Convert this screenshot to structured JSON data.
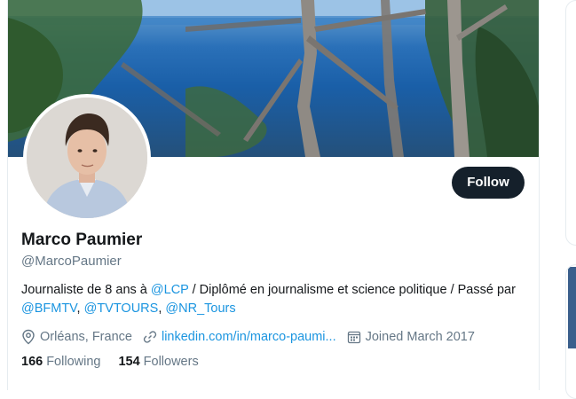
{
  "profile": {
    "name": "Marco Paumier",
    "handle": "@MarcoPaumier",
    "bio_parts": {
      "p1": "Journaliste de 8 ans à ",
      "m1": "@LCP",
      "p2": " / Diplômé en journalisme et science politique / Passé par ",
      "m2": "@BFMTV",
      "p3": ", ",
      "m3": "@TVTOURS",
      "p4": ", ",
      "m4": "@NR_Tours"
    },
    "location": "Orléans, France",
    "website": "linkedin.com/in/marco-paumi...",
    "joined": "Joined March 2017",
    "following_count": "166",
    "following_label": "Following",
    "followers_count": "154",
    "followers_label": "Followers"
  },
  "actions": {
    "follow_label": "Follow"
  },
  "icons": {
    "location": "location-pin-icon",
    "link": "link-icon",
    "calendar": "calendar-icon"
  },
  "colors": {
    "link": "#1b95e0",
    "follow_button": "#15202b",
    "secondary_text": "#657786"
  }
}
